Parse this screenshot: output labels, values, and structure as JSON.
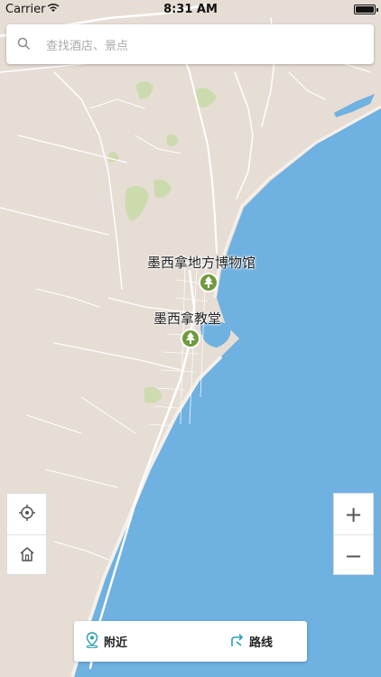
{
  "status_bar": {
    "carrier": "Carrier",
    "time": "8:31 AM",
    "battery_level": 1.0
  },
  "search": {
    "placeholder": "查找酒店、景点",
    "icon": "search-icon"
  },
  "pois": [
    {
      "label": "墨西拿地方博物馆",
      "icon": "tree-icon"
    },
    {
      "label": "墨西拿教堂",
      "icon": "tree-icon"
    }
  ],
  "map_controls": {
    "locate_icon": "crosshair-icon",
    "home_icon": "home-icon",
    "zoom_in_label": "+",
    "zoom_out_label": "−"
  },
  "bottom_bar": {
    "nearby_label": "附近",
    "nearby_icon": "location-pin-icon",
    "route_label": "路线",
    "route_icon": "route-icon"
  },
  "colors": {
    "land": "#e6ddd4",
    "sea": "#6fb1e1",
    "road": "#ffffff",
    "park": "#c8dba8",
    "poi_marker": "#6f9a3d",
    "accent": "#2a9fb0"
  }
}
